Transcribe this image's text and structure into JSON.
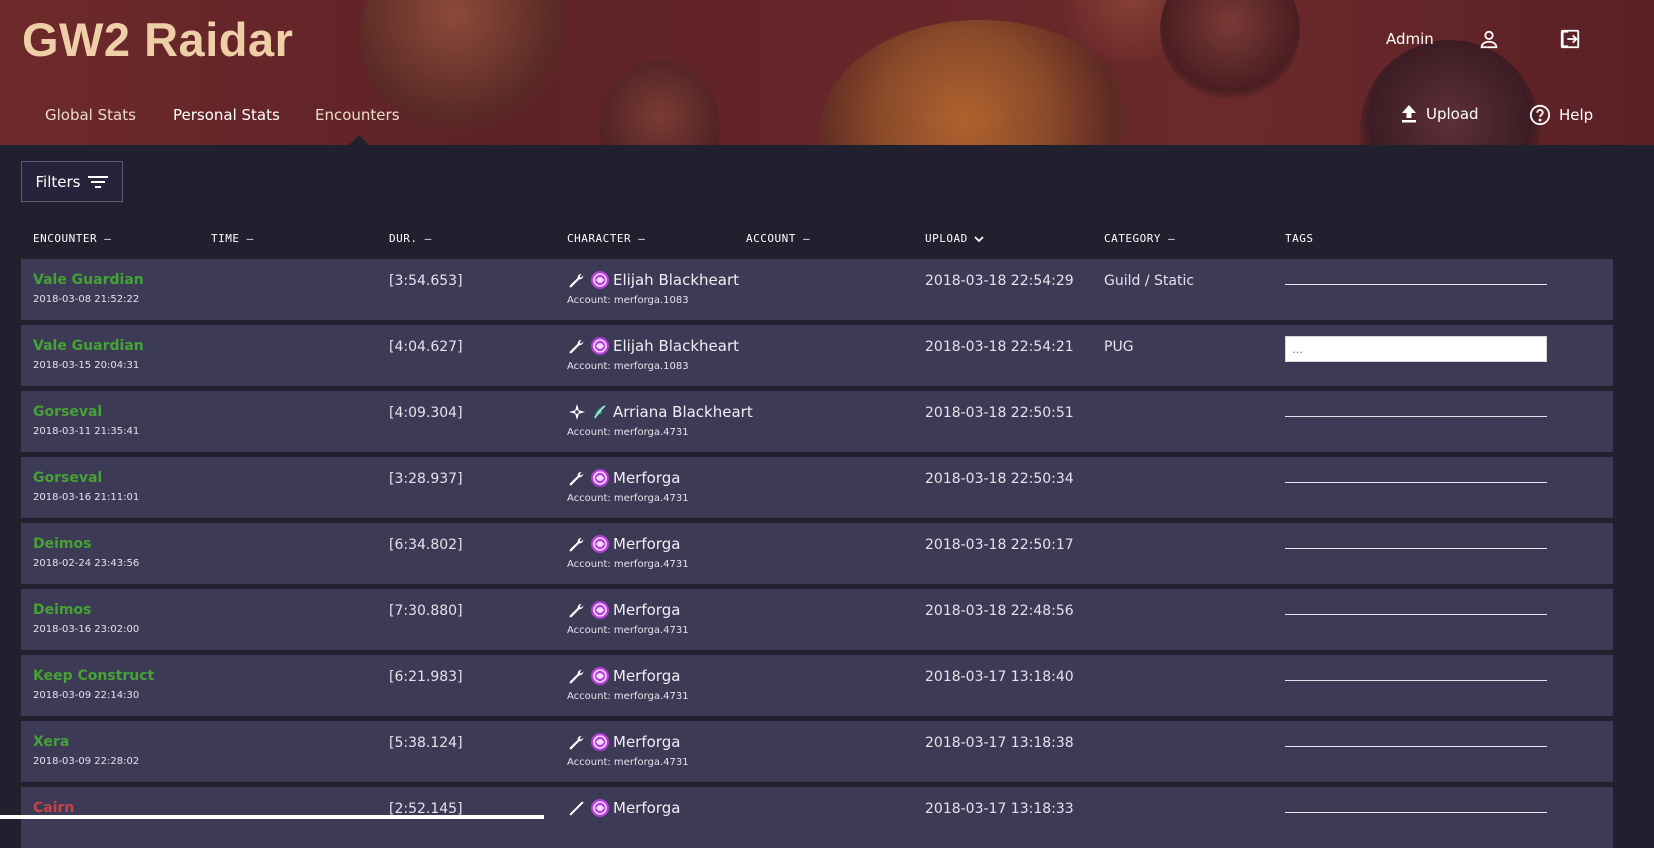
{
  "app": {
    "title": "GW2 Raidar"
  },
  "topbar": {
    "admin_label": "Admin",
    "profile_icon": "user-icon",
    "logout_icon": "logout-icon"
  },
  "nav": {
    "tabs": [
      {
        "label": "Global Stats"
      },
      {
        "label": "Personal Stats"
      },
      {
        "label": "Encounters",
        "active": true
      }
    ],
    "upload_label": "Upload",
    "help_label": "Help"
  },
  "filters": {
    "label": "Filters"
  },
  "table": {
    "columns": [
      "ENCOUNTER –",
      "TIME –",
      "DUR. –",
      "CHARACTER –",
      "ACCOUNT –",
      "UPLOAD",
      "CATEGORY –",
      "TAGS"
    ],
    "colors": {
      "success": "#45a235",
      "failure": "#c9424a",
      "row_bg": "#3d3a55"
    },
    "tags_placeholder": "…",
    "rows": [
      {
        "encounter": "Vale Guardian",
        "time": "2018-03-08 21:52:22",
        "duration": "[3:54.653]",
        "character": "Elijah Blackheart",
        "account": "Account: merforga.1083",
        "upload": "2018-03-18 22:54:29",
        "category": "Guild / Static",
        "success": true,
        "tool_icon": "wrench-icon",
        "profession_icon": "mesmer-icon"
      },
      {
        "encounter": "Vale Guardian",
        "time": "2018-03-15 20:04:31",
        "duration": "[4:04.627]",
        "character": "Elijah Blackheart",
        "account": "Account: merforga.1083",
        "upload": "2018-03-18 22:54:21",
        "category": "PUG",
        "success": true,
        "tool_icon": "wrench-icon",
        "profession_icon": "mesmer-icon",
        "tags_editing": true
      },
      {
        "encounter": "Gorseval",
        "time": "2018-03-11 21:35:41",
        "duration": "[4:09.304]",
        "character": "Arriana Blackheart",
        "account": "Account: merforga.4731",
        "upload": "2018-03-18 22:50:51",
        "category": "",
        "success": true,
        "tool_icon": "compass-icon",
        "profession_icon": "ranger-icon"
      },
      {
        "encounter": "Gorseval",
        "time": "2018-03-16 21:11:01",
        "duration": "[3:28.937]",
        "character": "Merforga",
        "account": "Account: merforga.4731",
        "upload": "2018-03-18 22:50:34",
        "category": "",
        "success": true,
        "tool_icon": "wrench-icon",
        "profession_icon": "mesmer-icon"
      },
      {
        "encounter": "Deimos",
        "time": "2018-02-24 23:43:56",
        "duration": "[6:34.802]",
        "character": "Merforga",
        "account": "Account: merforga.4731",
        "upload": "2018-03-18 22:50:17",
        "category": "",
        "success": true,
        "tool_icon": "wrench-icon",
        "profession_icon": "mesmer-icon"
      },
      {
        "encounter": "Deimos",
        "time": "2018-03-16 23:02:00",
        "duration": "[7:30.880]",
        "character": "Merforga",
        "account": "Account: merforga.4731",
        "upload": "2018-03-18 22:48:56",
        "category": "",
        "success": true,
        "tool_icon": "wrench-icon",
        "profession_icon": "mesmer-icon"
      },
      {
        "encounter": "Keep Construct",
        "time": "2018-03-09 22:14:30",
        "duration": "[6:21.983]",
        "character": "Merforga",
        "account": "Account: merforga.4731",
        "upload": "2018-03-17 13:18:40",
        "category": "",
        "success": true,
        "tool_icon": "wrench-icon",
        "profession_icon": "mesmer-icon"
      },
      {
        "encounter": "Xera",
        "time": "2018-03-09 22:28:02",
        "duration": "[5:38.124]",
        "character": "Merforga",
        "account": "Account: merforga.4731",
        "upload": "2018-03-17 13:18:38",
        "category": "",
        "success": true,
        "tool_icon": "wrench-icon",
        "profession_icon": "mesmer-icon"
      },
      {
        "encounter": "Cairn",
        "time": "",
        "duration": "[2:52.145]",
        "character": "Merforga",
        "account": "",
        "upload": "2018-03-17 13:18:33",
        "category": "",
        "success": false,
        "tool_icon": "sword-icon",
        "profession_icon": "mesmer-icon"
      }
    ]
  }
}
